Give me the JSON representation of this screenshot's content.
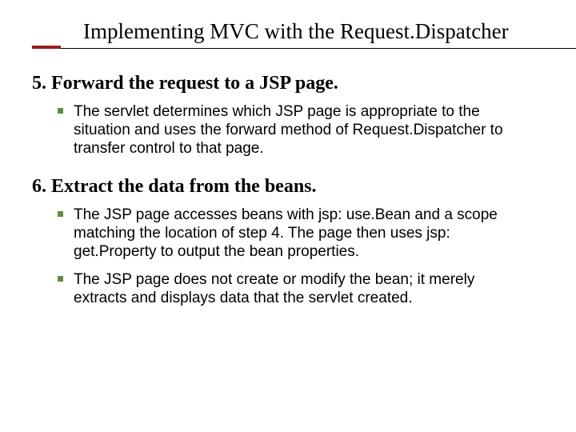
{
  "title": "Implementing MVC with the Request.Dispatcher",
  "steps": [
    {
      "heading": "5. Forward the request to a JSP page.",
      "bullets": [
        "The servlet determines which JSP page is appropriate to the situation and uses the forward method of Request.Dispatcher to transfer control to that page."
      ]
    },
    {
      "heading": "6. Extract the data from the beans.",
      "bullets": [
        "The JSP page accesses beans with jsp: use.Bean and a scope matching the location of step 4. The page then uses jsp: get.Property to output the bean properties.",
        "The JSP page does not create or modify the bean; it merely extracts and displays data that the servlet created."
      ]
    }
  ]
}
